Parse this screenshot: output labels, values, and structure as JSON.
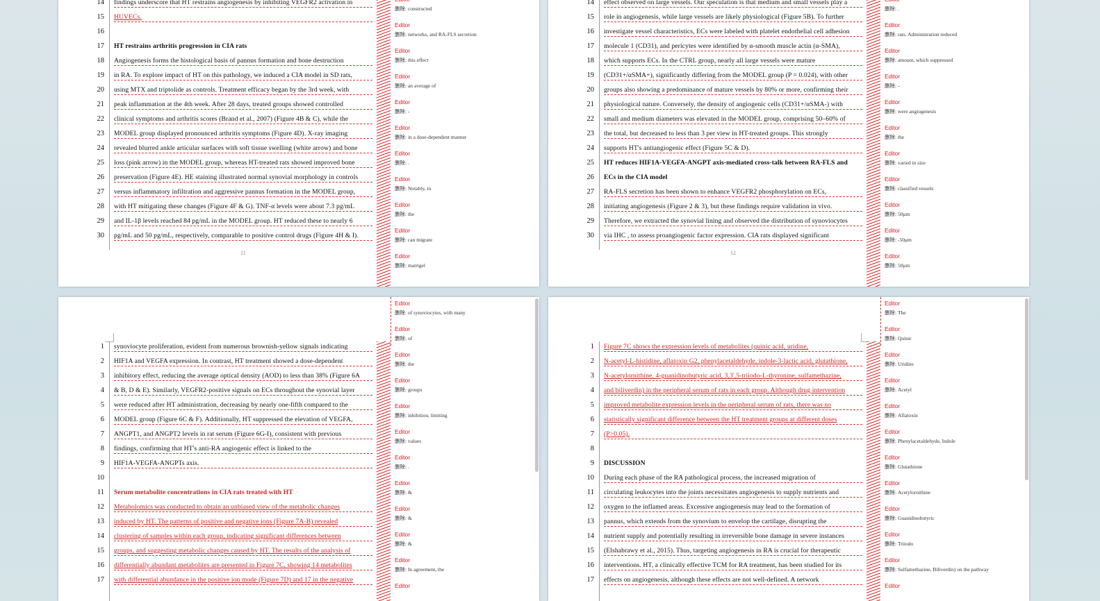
{
  "pages": [
    {
      "page_number": "11",
      "lines": [
        {
          "n": "14",
          "t": "findings underscore that HT restrains angiogenesis by inhibiting VEGFR2 activation in",
          "s": "normal"
        },
        {
          "n": "15",
          "t": "HUVECs.",
          "s": "red"
        },
        {
          "n": "16",
          "t": "",
          "s": "blank"
        },
        {
          "n": "17",
          "t": "HT restrains arthritis progression in CIA rats",
          "s": "head"
        },
        {
          "n": "18",
          "t": "      Angiogenesis forms the histological basis of pannus formation and bone destruction",
          "s": "normal"
        },
        {
          "n": "19",
          "t": "in RA. To explore impact of HT on this pathology, we induced a CIA model in SD rats,",
          "s": "normal"
        },
        {
          "n": "20",
          "t": "using MTX and triptolide as controls. Treatment efficacy began by the 3rd week, with",
          "s": "normal"
        },
        {
          "n": "21",
          "t": "peak inflammation at the 4th week. After 28 days, treated groups showed controlled",
          "s": "normal"
        },
        {
          "n": "22",
          "t": "clinical symptoms and arthritis scores (Brand et al., 2007) (Figure 4B & C), while the",
          "s": "normal"
        },
        {
          "n": "23",
          "t": "MODEL group displayed pronounced arthritis symptoms (Figure 4D). X-ray imaging",
          "s": "normal"
        },
        {
          "n": "24",
          "t": "revealed blurred ankle articular surfaces with soft tissue swelling (white arrow) and bone",
          "s": "normal"
        },
        {
          "n": "25",
          "t": "loss (pink arrow) in the MODEL group, whereas HT-treated rats showed improved bone",
          "s": "normal"
        },
        {
          "n": "26",
          "t": "preservation (Figure 4E). HE staining illustrated normal synovial morphology in controls",
          "s": "normal"
        },
        {
          "n": "27",
          "t": "versus inflammatory infiltration and aggressive pannus formation in the MODEL group,",
          "s": "normal"
        },
        {
          "n": "28",
          "t": "with HT mitigating these changes (Figure 4F & G). TNF-α levels were about 7.3 pg/mL",
          "s": "normal"
        },
        {
          "n": "29",
          "t": "and IL-1β levels reached 84 pg/mL in the MODEL group. HT reduced these to nearly 6",
          "s": "normal"
        },
        {
          "n": "30",
          "t": "pg/mL and 50 pg/mL, respectively, comparable to positive control drugs (Figure 4H & I).",
          "s": "normal"
        }
      ],
      "comments": [
        {
          "author": "Editor",
          "text": "删除: constructed"
        },
        {
          "author": "Editor",
          "text": "删除: networks, and RA-FLS secretion"
        },
        {
          "author": "Editor",
          "text": "删除: this effect"
        },
        {
          "author": "Editor",
          "text": "删除: an average of"
        },
        {
          "author": "Editor",
          "text": "删除: -"
        },
        {
          "author": "Editor",
          "text": "删除: in a dose-dependent manner"
        },
        {
          "author": "Editor",
          "text": "删除: ."
        },
        {
          "author": "Editor",
          "text": "删除: Notably, in"
        },
        {
          "author": "Editor",
          "text": "删除: the"
        },
        {
          "author": "Editor",
          "text": "删除: can migrate"
        },
        {
          "author": "Editor",
          "text": "删除: matrigel"
        }
      ]
    },
    {
      "page_number": "12",
      "lines": [
        {
          "n": "14",
          "t": "effect observed on large vessels. Our speculation is that medium and small vessels play a",
          "s": "normal"
        },
        {
          "n": "15",
          "t": "role in angiogenesis, while large vessels are likely physiological (Figure 5B). To further",
          "s": "normal"
        },
        {
          "n": "16",
          "t": "investigate vessel characteristics, ECs were labeled with platelet endothelial cell adhesion",
          "s": "normal"
        },
        {
          "n": "17",
          "t": "molecule 1 (CD31), and pericytes were identified by α-smooth muscle actin (α-SMA),",
          "s": "normal"
        },
        {
          "n": "18",
          "t": "which supports ECs. In the CTRL group, nearly all large vessels were mature",
          "s": "normal"
        },
        {
          "n": "19",
          "t": "(CD31+/αSMA+), significantly differing from the MODEL group (P = 0.024), with other",
          "s": "normal"
        },
        {
          "n": "20",
          "t": "groups also showing a predominance of mature vessels by 80% or more, confirming their",
          "s": "normal"
        },
        {
          "n": "21",
          "t": "physiological nature. Conversely, the density of angiogenic cells (CD31+/αSMA-) with",
          "s": "normal"
        },
        {
          "n": "22",
          "t": "small and medium diameters was elevated in the MODEL group, comprising 50–60% of",
          "s": "normal"
        },
        {
          "n": "23",
          "t": "the total, but decreased to less than 3 per view in HT-treated groups. This strongly",
          "s": "normal"
        },
        {
          "n": "24",
          "t": "supports HT's antiangiogenic effect (Figure 5C & D).",
          "s": "normal"
        },
        {
          "n": "25",
          "t": "HT reduces HIF1A-VEGFA-ANGPT axis-mediated cross-talk between RA-FLS and",
          "s": "head"
        },
        {
          "n": "26",
          "t": "ECs in the CIA model",
          "s": "head"
        },
        {
          "n": "27",
          "t": "      RA-FLS secretion has been shown to enhance VEGFR2 phosphorylation on ECs,",
          "s": "normal"
        },
        {
          "n": "28",
          "t": "initiating angiogenesis (Figure 2 & 3), but these findings require validation in vivo.",
          "s": "normal"
        },
        {
          "n": "29",
          "t": "Therefore, we extracted the synovial lining and observed the distribution of synoviocytes",
          "s": "normal"
        },
        {
          "n": "30",
          "t": "via IHC , to assess proangiogenic factor expression. CIA rats displayed significant",
          "s": "normal"
        }
      ],
      "comments": [
        {
          "author": "Editor",
          "text": "删除: ."
        },
        {
          "author": "Editor",
          "text": "删除: rats. Administration reduced"
        },
        {
          "author": "Editor",
          "text": "删除: amount, which suppressed"
        },
        {
          "author": "Editor",
          "text": "删除: -"
        },
        {
          "author": "Editor",
          "text": "删除: were angiogenesis"
        },
        {
          "author": "Editor",
          "text": "删除: the"
        },
        {
          "author": "Editor",
          "text": "删除:  varied in size"
        },
        {
          "author": "Editor",
          "text": "删除: classified vessels"
        },
        {
          "author": "Editor",
          "text": "删除: 50μm"
        },
        {
          "author": "Editor",
          "text": "删除: -50μm"
        },
        {
          "author": "Editor",
          "text": "删除: 50μm"
        }
      ]
    },
    {
      "page_number": "",
      "lines": [
        {
          "n": "1",
          "t": "synoviocyte proliferation, evident from numerous brownish-yellow signals indicating",
          "s": "normal"
        },
        {
          "n": "2",
          "t": "HIF1A and VEGFA expression. In contrast, HT treatment showed a dose-dependent",
          "s": "normal"
        },
        {
          "n": "3",
          "t": "inhibitory effect, reducing the average optical density (AOD) to less than 38% (Figure 6A",
          "s": "normal"
        },
        {
          "n": "4",
          "t": "& B, D & E). Similarly, VEGFR2-positive signals on ECs throughout the synovial layer",
          "s": "normal"
        },
        {
          "n": "5",
          "t": "were reduced after HT administration, decreasing by nearly one-fifth compared to the",
          "s": "normal"
        },
        {
          "n": "6",
          "t": "MODEL group (Figure 6C & F). Additionally, HT suppressed the elevation of VEGFA,",
          "s": "normal"
        },
        {
          "n": "7",
          "t": "ANGPT1, and ANGPT2 levels in rat serum (Figure 6G-I), consistent with previous",
          "s": "normal"
        },
        {
          "n": "8",
          "t": "findings, confirming that HT's anti-RA angiogenic effect is linked to the",
          "s": "normal"
        },
        {
          "n": "9",
          "t": "HIF1A-VEGFA-ANGPTs axis.",
          "s": "normal"
        },
        {
          "n": "10",
          "t": "",
          "s": "blank"
        },
        {
          "n": "11",
          "t": "Serum metabolite concentrations in CIA rats treated with HT",
          "s": "headred"
        },
        {
          "n": "12",
          "t": "      Metabolomics was conducted to obtain an unbiased view of the metabolic changes",
          "s": "red"
        },
        {
          "n": "13",
          "t": "induced by HT. The patterns of positive and negative ions (Figure 7A-B) revealed",
          "s": "red"
        },
        {
          "n": "14",
          "t": "clustering of samples within each group, indicating significant differences between",
          "s": "red"
        },
        {
          "n": "15",
          "t": "groups, and suggesting metabolic changes caused by HT. The results of the analysis of",
          "s": "red"
        },
        {
          "n": "16",
          "t": "differentially abundant metabolites are presented in Figure 7C, showing 14 metabolites",
          "s": "red"
        },
        {
          "n": "17",
          "t": "with differential abundance in the positive ion mode (Figure 7D) and 17 in the negative",
          "s": "red"
        }
      ],
      "comments": [
        {
          "author": "Editor",
          "text": "删除: of synoviocytes, with many"
        },
        {
          "author": "Editor",
          "text": "删除: of"
        },
        {
          "author": "Editor",
          "text": "删除: the"
        },
        {
          "author": "Editor",
          "text": "删除: groups"
        },
        {
          "author": "Editor",
          "text": "删除: inhibition, limiting"
        },
        {
          "author": "Editor",
          "text": "删除: values"
        },
        {
          "author": "Editor",
          "text": "删除: ."
        },
        {
          "author": "Editor",
          "text": "删除: &"
        },
        {
          "author": "Editor",
          "text": "删除: &"
        },
        {
          "author": "Editor",
          "text": "删除: &"
        },
        {
          "author": "Editor",
          "text": "删除: In agreement, the"
        },
        {
          "author": "Editor",
          "text": ""
        }
      ]
    },
    {
      "page_number": "",
      "lines": [
        {
          "n": "1",
          "t": "Figure 7C shows the expression levels of metabolites (quinic acid, uridine,",
          "s": "red"
        },
        {
          "n": "2",
          "t": "N-acetyl-L-histidine, aflatoxin G2, phenylacetaldehyde, indole-3-lactic acid, glutathione,",
          "s": "red"
        },
        {
          "n": "3",
          "t": "N-acetylornithine, 4-guanidinobutyric acid, 3,3',5-triiodo-L-thyronine, sulfamethazine,",
          "s": "red"
        },
        {
          "n": "4",
          "t": "and biliverdin) in the peripheral serum of rats in each group. Although drug intervention",
          "s": "red"
        },
        {
          "n": "5",
          "t": "improved metabolite expression levels in the peripheral serum of rats, there was no",
          "s": "red"
        },
        {
          "n": "6",
          "t": "statistically significant difference between the HT treatment groups at different doses",
          "s": "red"
        },
        {
          "n": "7",
          "t": "(P>0.05).",
          "s": "red"
        },
        {
          "n": "8",
          "t": "",
          "s": "blank"
        },
        {
          "n": "9",
          "t": "DISCUSSION",
          "s": "head"
        },
        {
          "n": "10",
          "t": "      During each phase of the RA pathological process, the increased migration of",
          "s": "normal"
        },
        {
          "n": "11",
          "t": "circulating leukocytes into the joints necessitates angiogenesis to supply nutrients and",
          "s": "normal"
        },
        {
          "n": "12",
          "t": "oxygen to the inflamed areas. Excessive angiogenesis may lead to the formation of",
          "s": "normal"
        },
        {
          "n": "13",
          "t": "pannus, which extends from the synovium to envelop the cartilage, disrupting the",
          "s": "normal"
        },
        {
          "n": "14",
          "t": "nutrient supply and potentially resulting in irreversible bone damage in severe instances",
          "s": "normal"
        },
        {
          "n": "15",
          "t": "(Elshabrawy et al., 2015). Thus, targeting angiogenesis in RA is crucial for therapeutic",
          "s": "normal"
        },
        {
          "n": "16",
          "t": "interventions. HT, a clinically effective TCM for RA treatment, has been studied for its",
          "s": "normal"
        },
        {
          "n": "17",
          "t": "effects on angiogenesis, although these effects are not well-defined. A network",
          "s": "normal"
        }
      ],
      "comments": [
        {
          "author": "Editor",
          "text": "删除: The"
        },
        {
          "author": "Editor",
          "text": "删除: Quinic"
        },
        {
          "author": "Editor",
          "text": "删除: Uridine"
        },
        {
          "author": "Editor",
          "text": "删除: Acetyl"
        },
        {
          "author": "Editor",
          "text": "删除: Aflatoxin"
        },
        {
          "author": "Editor",
          "text": "删除: Phenylacetaldehyde, Indole"
        },
        {
          "author": "Editor",
          "text": "删除: Glutathione"
        },
        {
          "author": "Editor",
          "text": "删除: Acetylornithine"
        },
        {
          "author": "Editor",
          "text": "删除: Guanidinobutyric"
        },
        {
          "author": "Editor",
          "text": "删除: Triiodo"
        },
        {
          "author": "Editor",
          "text": "删除: Sulfamethazine, Biliverdin) on the pathway"
        },
        {
          "author": "Editor",
          "text": ""
        }
      ]
    }
  ]
}
